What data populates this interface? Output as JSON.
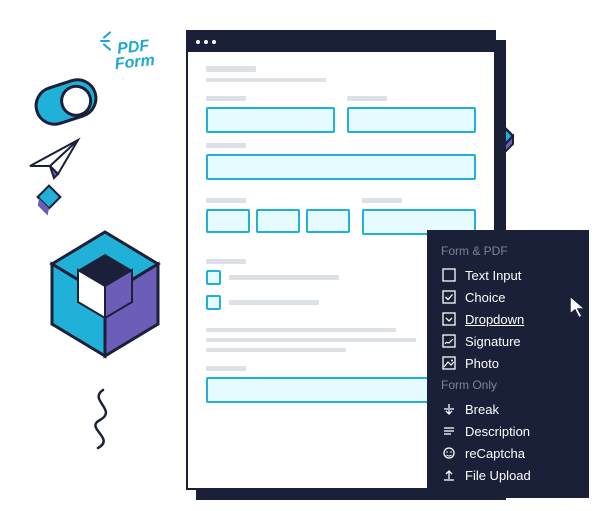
{
  "decor": {
    "pdf_label_line1": "PDF",
    "pdf_label_line2": "Form"
  },
  "menu": {
    "header1": "Form & PDF",
    "header2": "Form Only",
    "items_formpdf": [
      {
        "label": "Text Input",
        "icon": "text-input-icon"
      },
      {
        "label": "Choice",
        "icon": "choice-icon"
      },
      {
        "label": "Dropdown",
        "icon": "dropdown-icon",
        "selected": true
      },
      {
        "label": "Signature",
        "icon": "signature-icon"
      },
      {
        "label": "Photo",
        "icon": "photo-icon"
      }
    ],
    "items_formonly": [
      {
        "label": "Break",
        "icon": "break-icon"
      },
      {
        "label": "Description",
        "icon": "description-icon"
      },
      {
        "label": "reCaptcha",
        "icon": "recaptcha-icon"
      },
      {
        "label": "File Upload",
        "icon": "file-upload-icon"
      }
    ]
  }
}
